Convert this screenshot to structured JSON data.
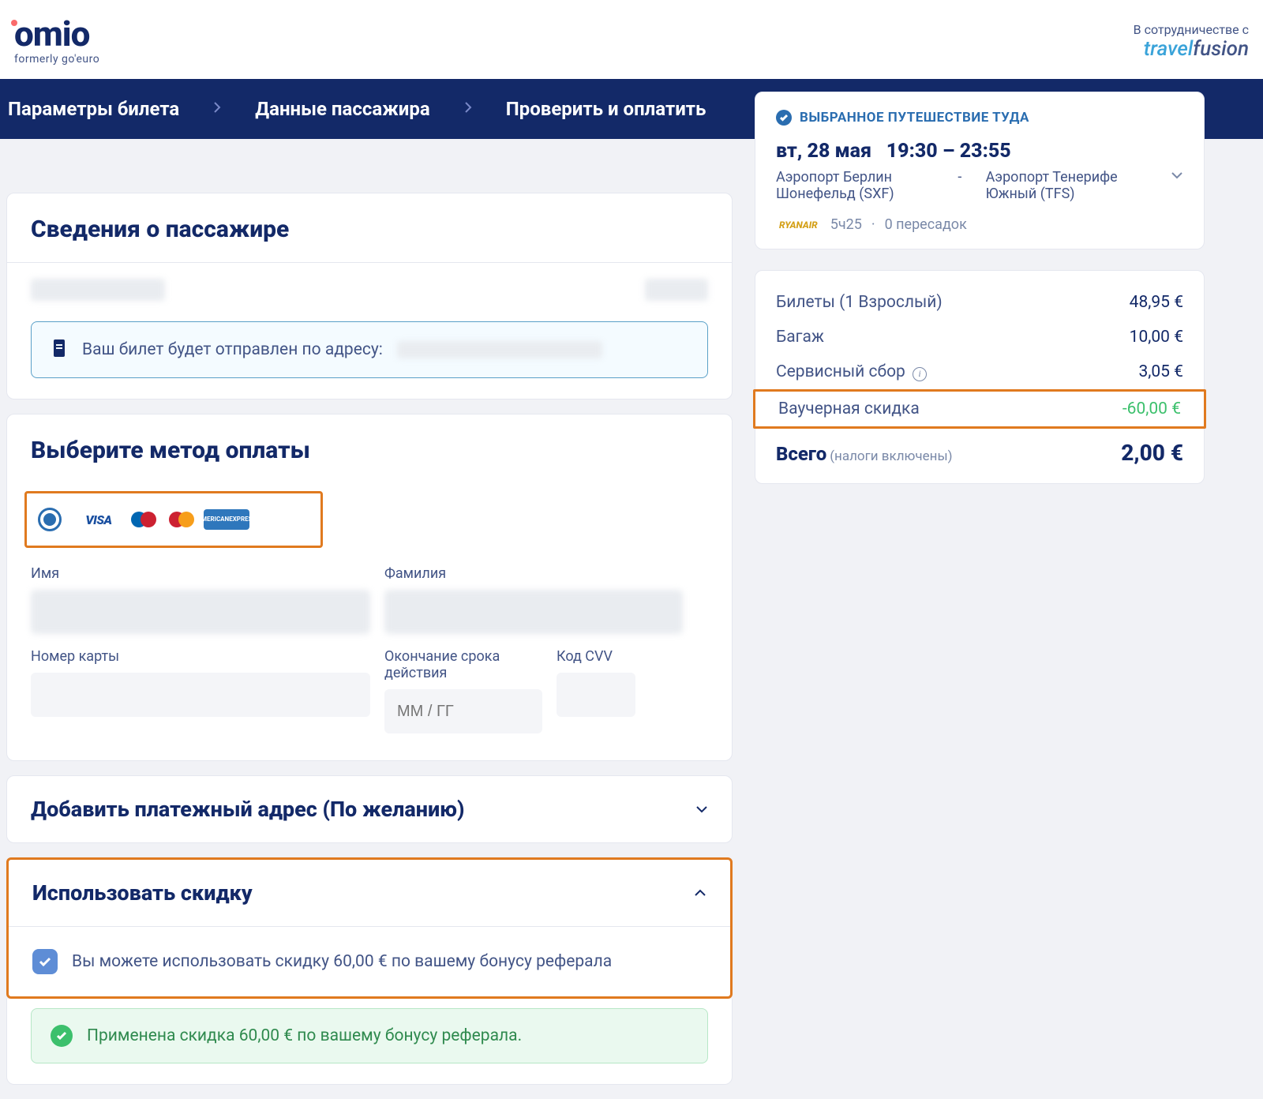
{
  "header": {
    "logo_main": "omio",
    "logo_sub": "formerly go'euro",
    "partner_label": "В сотрудничестве с",
    "partner_brand_a": "travel",
    "partner_brand_b": "fusion"
  },
  "breadcrumb": {
    "step1": "Параметры билета",
    "step2": "Данные пассажира",
    "step3": "Проверить и оплатить"
  },
  "passenger": {
    "title": "Сведения о пассажире",
    "ticket_notice": "Ваш билет будет отправлен по адресу:"
  },
  "payment": {
    "title": "Выберите метод оплаты",
    "brands": {
      "visa": "VISA",
      "amex_l1": "AMERICAN",
      "amex_l2": "EXPRESS"
    },
    "labels": {
      "first_name": "Имя",
      "last_name": "Фамилия",
      "card_number": "Номер карты",
      "expiry": "Окончание срока действия",
      "cvv": "Код CVV"
    },
    "placeholders": {
      "expiry": "ММ / ГГ"
    }
  },
  "billing": {
    "title": "Добавить платежный адрес (По желанию)"
  },
  "discount": {
    "title": "Использовать скидку",
    "checkbox_text": "Вы можете использовать скидку 60,00 € по вашему бонусу реферала",
    "applied_text": "Применена скидка 60,00 € по вашему бонусу реферала."
  },
  "trip": {
    "badge": "ВЫБРАННОЕ ПУТЕШЕСТВИЕ ТУДА",
    "date": "вт, 28 мая",
    "time": "19:30 – 23:55",
    "origin": "Аэропорт Берлин Шонефельд (SXF)",
    "dest": "Аэропорт Тенерифе Южный (TFS)",
    "carrier_brand": "RYANAIR",
    "duration": "5ч25",
    "dot": "·",
    "transfers": "0 пересадок"
  },
  "price": {
    "tickets_label": "Билеты  (1 Взрослый)",
    "tickets_value": "48,95 €",
    "baggage_label": "Багаж",
    "baggage_value": "10,00 €",
    "fee_label": "Сервисный сбор",
    "fee_value": "3,05 €",
    "voucher_label": "Ваучерная скидка",
    "voucher_value": "-60,00 €",
    "total_label": "Всего",
    "total_sub": "(налоги включены)",
    "total_value": "2,00 €"
  }
}
